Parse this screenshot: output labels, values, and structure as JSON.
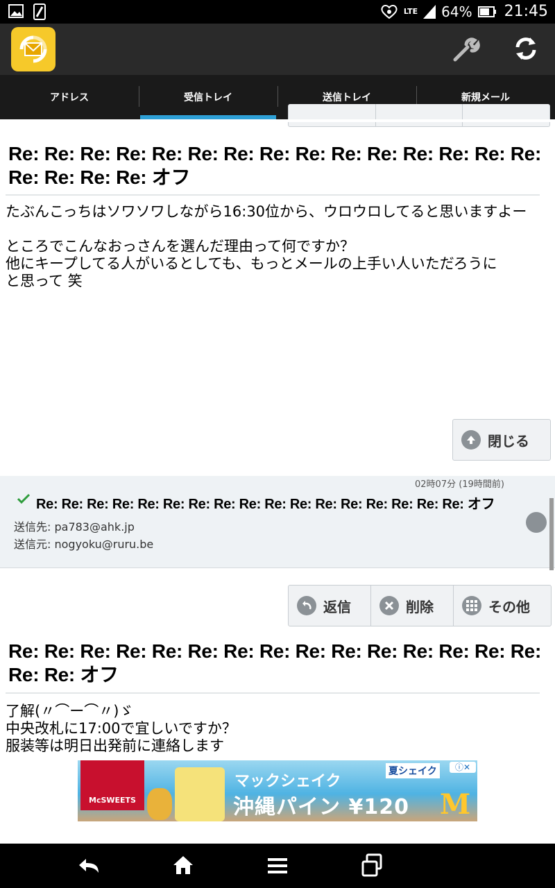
{
  "status_bar": {
    "network": "LTE",
    "battery": "64%",
    "time": "21:45"
  },
  "tabs": [
    {
      "label": "アドレス"
    },
    {
      "label": "受信トレイ"
    },
    {
      "label": "送信トレイ"
    },
    {
      "label": "新規メール"
    }
  ],
  "message1": {
    "subject": "Re: Re: Re: Re: Re: Re: Re: Re: Re: Re: Re: Re: Re: Re: Re: Re: Re: Re: Re: オフ",
    "body": [
      "たぶんこっちはソワソワしながら16:30位から、ウロウロしてると思いますよー",
      "",
      "ところでこんなおっさんを選んだ理由って何ですか？",
      "他にキープしてる人がいるとしても、もっとメールの上手い人いただろうに",
      "と思って 笑"
    ],
    "close_label": "閉じる"
  },
  "message2": {
    "time": "02時07分 (19時間前)",
    "header_subject": "Re: Re: Re: Re: Re: Re: Re: Re: Re: Re: Re: Re: Re: Re: Re: Re: Re: オフ",
    "to": "送信先: pa783@ahk.jp",
    "from": "送信元: nogyoku@ruru.be",
    "actions": {
      "reply": "返信",
      "delete": "削除",
      "other": "その他"
    },
    "subject": "Re: Re: Re: Re: Re: Re: Re: Re: Re: Re: Re: Re: Re: Re: Re: Re: Re: オフ",
    "body": [
      "了解(〃⌒ー⌒〃)ゞ",
      "中央改札に17:00で宜しいですか？",
      "服装等は明日出発前に連絡します"
    ]
  },
  "ad": {
    "brand": "McSWEETS",
    "headline": "マックシェイク",
    "product": "沖縄パイン ¥120",
    "tag": "夏シェイク"
  },
  "colors": {
    "accent": "#2ea0d6",
    "appbar": "#2a2a2a",
    "tabs": "#1a1a1a",
    "header_bg": "#eef2f5"
  }
}
